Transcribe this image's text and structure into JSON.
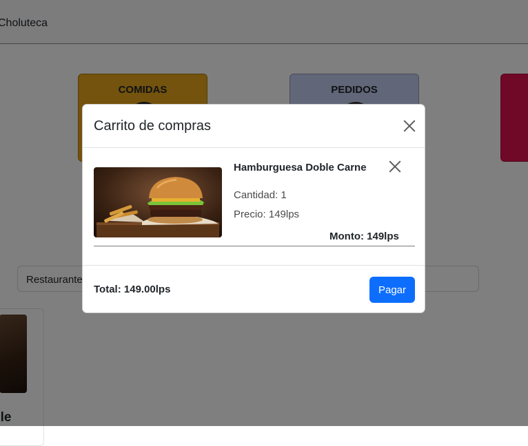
{
  "navbar": {
    "brand": "Choluteca"
  },
  "categories": [
    {
      "title": "COMIDAS"
    },
    {
      "title": "PEDIDOS"
    }
  ],
  "search": {
    "value": "Restaurante"
  },
  "product_card": {
    "name_partial": "ble"
  },
  "cart_modal": {
    "title": "Carrito de compras",
    "item": {
      "name": "Hamburguesa Doble Carne",
      "quantity": "Cantidad: 1",
      "price": "Precio: 149lps",
      "amount": "Monto: 149lps",
      "image_icon": "burger-photo"
    },
    "total": "Total: 149.00lps",
    "pay_label": "Pagar"
  },
  "colors": {
    "comidas": "#e6a61a",
    "pedidos": "#c3cdf0",
    "accent_pink": "#e0104f",
    "primary_button": "#0d6efd"
  }
}
